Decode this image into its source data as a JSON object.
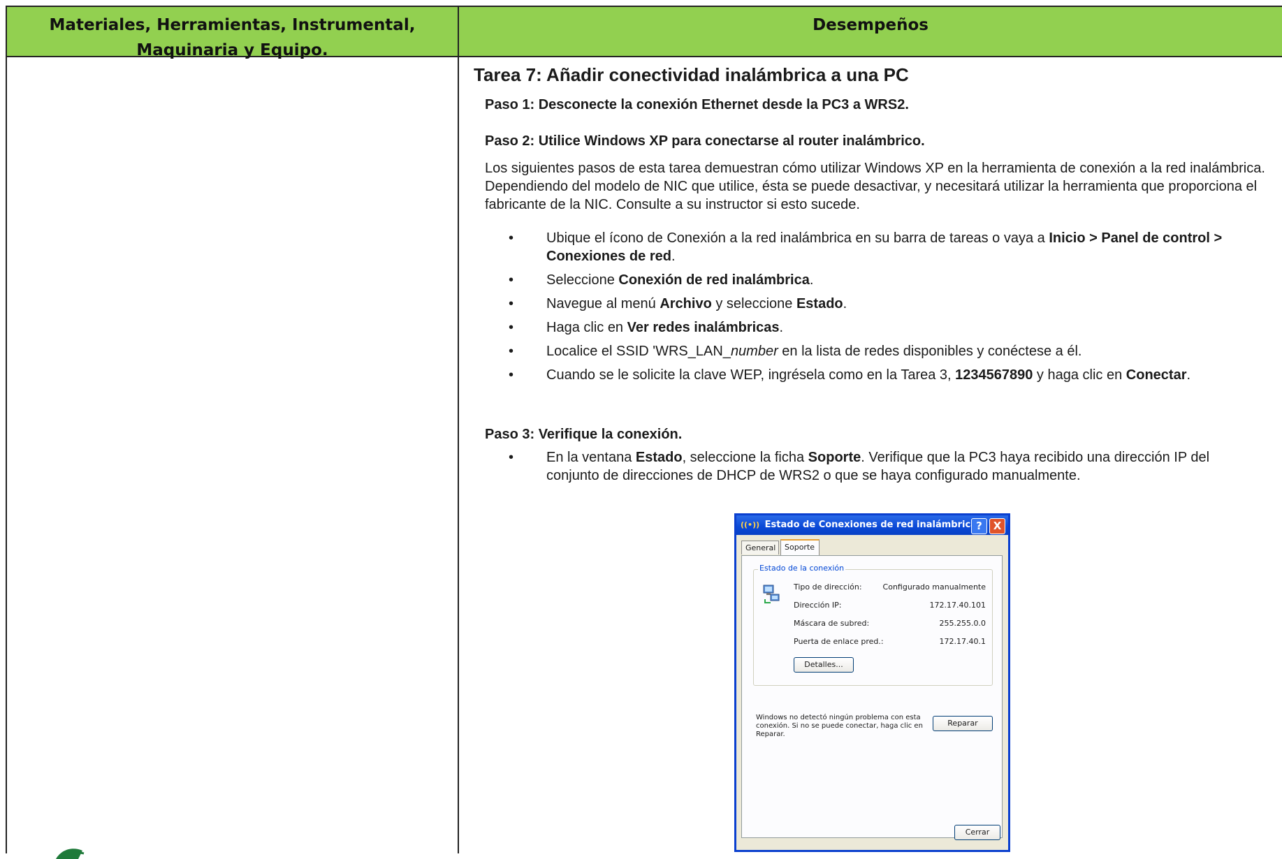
{
  "header": {
    "left_line1": "Materiales, Herramientas, Instrumental,",
    "left_line2": "Maquinaria y Equipo.",
    "right": "Desempeños"
  },
  "content": {
    "title": "Tarea 7: Añadir conectividad inalámbrica a una PC",
    "step1": "Paso 1: Desconecte la conexión Ethernet desde la PC3 a WRS2.",
    "step2": "Paso 2: Utilice Windows XP para conectarse al router inalámbrico.",
    "paragraph": "Los siguientes pasos de esta tarea demuestran cómo utilizar Windows XP en la herramienta de conexión a la red inalámbrica. Dependiendo del modelo de NIC que utilice, ésta se puede desactivar, y necesitará utilizar la herramienta que proporciona el fabricante de la NIC. Consulte a su instructor si esto sucede.",
    "bullets": [
      {
        "a": "Ubique el ícono de Conexión a la red inalámbrica en su barra de tareas o vaya a ",
        "b": "Inicio > Panel de control > Conexiones de red",
        "c": "."
      },
      {
        "a": "Seleccione ",
        "b": "Conexión de red inalámbrica",
        "c": "."
      },
      {
        "a": "Navegue al menú ",
        "b": "Archivo",
        "c": " y seleccione ",
        "d": "Estado",
        "e": "."
      },
      {
        "a": "Haga clic en ",
        "b": "Ver redes inalámbricas",
        "c": "."
      },
      {
        "a": "Localice el SSID 'WRS_LAN_",
        "i": "number",
        "c": " en la lista de redes disponibles y conéctese a él."
      },
      {
        "a": "Cuando se le solicite la clave WEP, ingrésela como en la Tarea 3, ",
        "b": "1234567890",
        "c": " y haga clic en ",
        "d": "Conectar",
        "e": "."
      }
    ],
    "step3": "Paso 3: Verifique la conexión.",
    "bullet3": {
      "a": "En la ventana ",
      "b": "Estado",
      "c": ", seleccione la ficha ",
      "d": "Soporte",
      "e": ". Verifique que la PC3 haya recibido una dirección IP del conjunto de direcciones de DHCP de WRS2 o que se haya configurado manualmente."
    }
  },
  "dialog": {
    "title": "Estado de Conexiones de red inalámbricas",
    "help": "?",
    "close": "X",
    "tab_general": "General",
    "tab_soporte": "Soporte",
    "group_label": "Estado de la conexión",
    "rows": [
      {
        "k": "Tipo de dirección:",
        "v": "Configurado manualmente"
      },
      {
        "k": "Dirección IP:",
        "v": "172.17.40.101"
      },
      {
        "k": "Máscara de subred:",
        "v": "255.255.0.0"
      },
      {
        "k": "Puerta de enlace pred.:",
        "v": "172.17.40.1"
      }
    ],
    "detalles": "Detalles...",
    "message": "Windows no detectó ningún problema con esta conexión. Si no se puede conectar, haga clic en Reparar.",
    "reparar": "Reparar",
    "cerrar": "Cerrar",
    "colors": {
      "titlebar": "#0a48d6",
      "header_green": "#92d050"
    }
  }
}
